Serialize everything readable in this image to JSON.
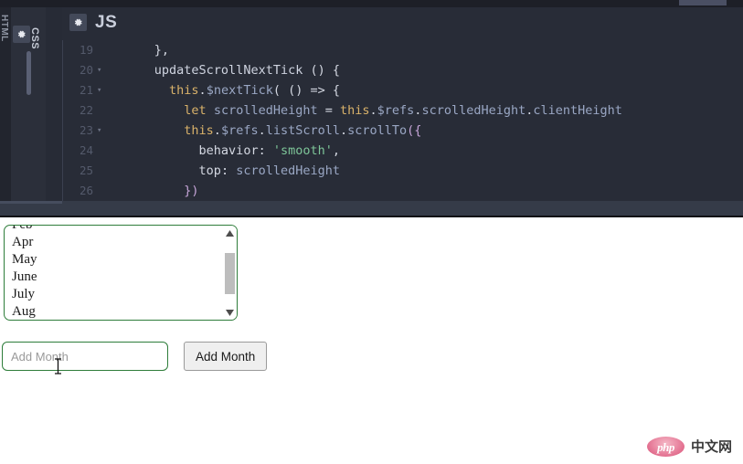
{
  "editor": {
    "vertical_tabs": [
      {
        "label": "HTML",
        "icon": "gear-icon"
      },
      {
        "label": "CSS",
        "icon": "gear-icon"
      }
    ],
    "active_tab": {
      "label": "JS",
      "icon": "gear-icon"
    },
    "code_lines": [
      {
        "number": "19",
        "fold": "",
        "tokens": [
          {
            "text": "      ",
            "cls": "t-plain"
          },
          {
            "text": "},",
            "cls": "t-punct"
          }
        ]
      },
      {
        "number": "20",
        "fold": "▾",
        "tokens": [
          {
            "text": "      ",
            "cls": "t-plain"
          },
          {
            "text": "updateScrollNextTick",
            "cls": "t-fn"
          },
          {
            "text": " () {",
            "cls": "t-punct"
          }
        ]
      },
      {
        "number": "21",
        "fold": "▾",
        "tokens": [
          {
            "text": "        ",
            "cls": "t-plain"
          },
          {
            "text": "this",
            "cls": "t-this"
          },
          {
            "text": ".",
            "cls": "t-punct"
          },
          {
            "text": "$nextTick",
            "cls": "t-prop"
          },
          {
            "text": "( () => {",
            "cls": "t-punct"
          }
        ]
      },
      {
        "number": "22",
        "fold": "",
        "tokens": [
          {
            "text": "          ",
            "cls": "t-plain"
          },
          {
            "text": "let",
            "cls": "t-kw"
          },
          {
            "text": " ",
            "cls": "t-plain"
          },
          {
            "text": "scrolledHeight",
            "cls": "t-prop"
          },
          {
            "text": " = ",
            "cls": "t-punct"
          },
          {
            "text": "this",
            "cls": "t-this"
          },
          {
            "text": ".",
            "cls": "t-punct"
          },
          {
            "text": "$refs",
            "cls": "t-member"
          },
          {
            "text": ".",
            "cls": "t-punct"
          },
          {
            "text": "scrolledHeight",
            "cls": "t-member"
          },
          {
            "text": ".",
            "cls": "t-punct"
          },
          {
            "text": "clientHeight",
            "cls": "t-member"
          }
        ]
      },
      {
        "number": "23",
        "fold": "▾",
        "tokens": [
          {
            "text": "          ",
            "cls": "t-plain"
          },
          {
            "text": "this",
            "cls": "t-this"
          },
          {
            "text": ".",
            "cls": "t-punct"
          },
          {
            "text": "$refs",
            "cls": "t-member"
          },
          {
            "text": ".",
            "cls": "t-punct"
          },
          {
            "text": "listScroll",
            "cls": "t-member"
          },
          {
            "text": ".",
            "cls": "t-punct"
          },
          {
            "text": "scrollTo",
            "cls": "t-member"
          },
          {
            "text": "({",
            "cls": "t-paren"
          }
        ]
      },
      {
        "number": "24",
        "fold": "",
        "tokens": [
          {
            "text": "            ",
            "cls": "t-plain"
          },
          {
            "text": "behavior",
            "cls": "t-plain"
          },
          {
            "text": ": ",
            "cls": "t-punct"
          },
          {
            "text": "'smooth'",
            "cls": "t-str"
          },
          {
            "text": ",",
            "cls": "t-punct"
          }
        ]
      },
      {
        "number": "25",
        "fold": "",
        "tokens": [
          {
            "text": "            ",
            "cls": "t-plain"
          },
          {
            "text": "top",
            "cls": "t-plain"
          },
          {
            "text": ": ",
            "cls": "t-punct"
          },
          {
            "text": "scrolledHeight",
            "cls": "t-prop"
          }
        ]
      },
      {
        "number": "26",
        "fold": "",
        "tokens": [
          {
            "text": "          ",
            "cls": "t-plain"
          },
          {
            "text": "})",
            "cls": "t-paren"
          }
        ]
      }
    ]
  },
  "preview": {
    "month_list": {
      "items": [
        "Feb",
        "Apr",
        "May",
        "June",
        "July",
        "Aug"
      ],
      "scrollbar": {
        "up_arrow_icon": "triangle-up-icon",
        "down_arrow_icon": "triangle-down-icon"
      }
    },
    "add_row": {
      "input_placeholder": "Add Month",
      "input_value": "",
      "button_label": "Add Month"
    }
  },
  "watermark": {
    "logo_text": "php",
    "text": "中文网"
  },
  "colors": {
    "accent_green": "#2e7d3a",
    "editor_bg": "#282c37",
    "divider": "#353b48",
    "string_green": "#7ec699",
    "keyword_gold": "#d9b26a",
    "property_blue": "#9aa7c4"
  }
}
